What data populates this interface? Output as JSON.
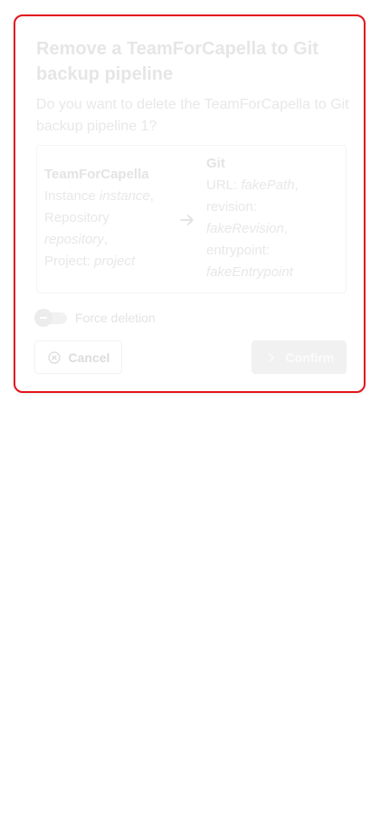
{
  "dialog": {
    "title": "Remove a TeamForCapella to Git backup pipeline",
    "question": "Do you want to delete the TeamForCapella to Git backup pipeline 1?",
    "source": {
      "heading": "TeamForCapella",
      "instance_label": "Instance",
      "instance_value": "instance",
      "repository_label": "Repository",
      "repository_value": "repository",
      "project_label": "Project:",
      "project_value": "project"
    },
    "target": {
      "heading": "Git",
      "url_label": "URL:",
      "url_value": "fakePath",
      "revision_label": "revision:",
      "revision_value": "fakeRevision",
      "entrypoint_label": "entrypoint:",
      "entrypoint_value": "fakeEntrypoint"
    },
    "force_deletion": {
      "label": "Force deletion",
      "checked": false
    },
    "buttons": {
      "cancel_label": "Cancel",
      "confirm_label": "Confirm"
    },
    "icons": {
      "cancel": "cancel-circle-icon",
      "confirm": "chevron-right-icon",
      "arrow": "arrow-right-icon"
    },
    "colors": {
      "border_accent": "#e3141b"
    }
  }
}
